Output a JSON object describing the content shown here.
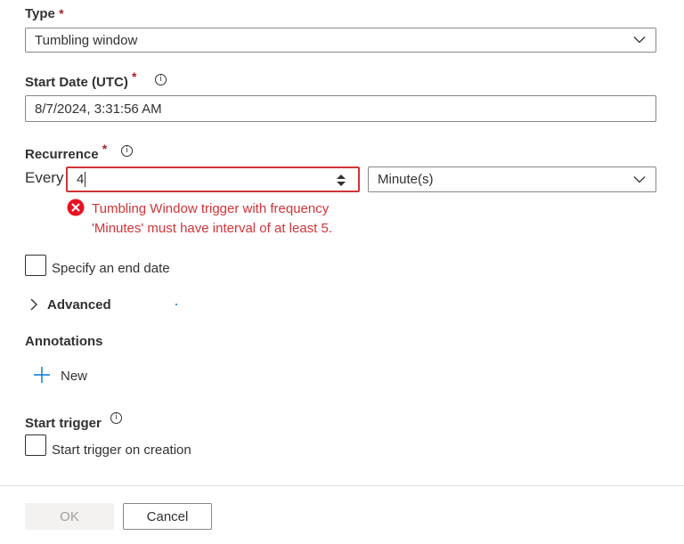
{
  "type_field": {
    "label": "Type",
    "required": "*",
    "value": "Tumbling window",
    "icon": "chevron-down-icon"
  },
  "start_date": {
    "label": "Start Date (UTC)",
    "required": "*",
    "value": "8/7/2024, 3:31:56 AM",
    "info_icon": "info-icon"
  },
  "recurrence": {
    "label": "Recurrence",
    "required": "*",
    "every_label": "Every",
    "interval_value": "4",
    "unit_value": "Minute(s)",
    "error_line1": "Tumbling Window trigger with frequency",
    "error_line2": "'Minutes' must have interval of at least 5.",
    "error_color": "#d13438"
  },
  "end_date": {
    "label": "Specify an end date",
    "checked": false
  },
  "advanced": {
    "label": "Advanced",
    "icon": "chevron-right-icon"
  },
  "annotations": {
    "label": "Annotations",
    "new_label": "New",
    "icon": "plus-icon"
  },
  "start_trigger": {
    "label": "Start trigger",
    "checkbox_label": "Start trigger on creation",
    "checked": false
  },
  "footer": {
    "ok_label": "OK",
    "cancel_label": "Cancel"
  },
  "colors": {
    "accent": "#0078d4",
    "error": "#d13438",
    "disabled_bg": "#f3f2f1",
    "disabled_text": "#a19f9d"
  }
}
